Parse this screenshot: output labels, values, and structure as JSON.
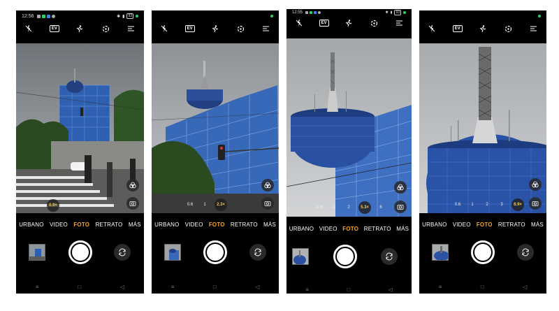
{
  "phones": [
    {
      "time": "12:56",
      "battery": "93",
      "zoom_selected": "0.9×"
    },
    {
      "zoom_options": [
        "0.6",
        "1",
        "2.3×"
      ]
    },
    {
      "time": "12:55",
      "battery": "93",
      "zoom_options": [
        "0.6",
        "1",
        "2",
        "5.3×",
        "6"
      ]
    },
    {
      "zoom_options": [
        "0.6",
        "1",
        "2",
        "3",
        "8.9×"
      ]
    }
  ],
  "toolbar": {
    "ev_label": "EV"
  },
  "modes": [
    "URBANO",
    "VIDEO",
    "FOTO",
    "RETRATO",
    "MÁS"
  ],
  "icons": {
    "flash": "flash-off-icon",
    "ev": "exposure-icon",
    "motion": "motion-icon",
    "lens": "lens-icon",
    "menu": "menu-icon",
    "filters": "filters-icon",
    "mode": "camera-mode-icon",
    "flip": "flip-camera-icon"
  },
  "colors": {
    "active_mode": "#f6a623",
    "zoom_selected": "#f6c844",
    "status_dot": "#30d158"
  }
}
